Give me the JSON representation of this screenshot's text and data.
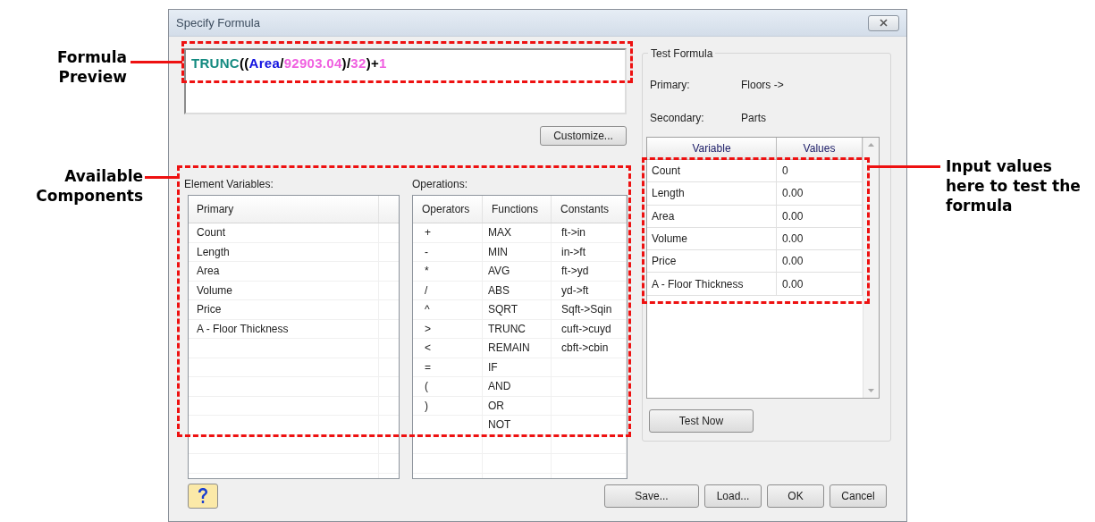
{
  "window": {
    "title": "Specify Formula"
  },
  "formula": [
    {
      "text": "TRUNC",
      "color": "#138a80"
    },
    {
      "text": "((",
      "color": "#000000"
    },
    {
      "text": "Area",
      "color": "#1010e0"
    },
    {
      "text": "/",
      "color": "#000000"
    },
    {
      "text": "92903.04",
      "color": "#f060e0"
    },
    {
      "text": ")/",
      "color": "#000000"
    },
    {
      "text": "32",
      "color": "#f060e0"
    },
    {
      "text": ")+",
      "color": "#000000"
    },
    {
      "text": "1",
      "color": "#f060e0"
    }
  ],
  "customize_button": "Customize...",
  "element_variables": {
    "label": "Element Variables:",
    "column": "Primary",
    "items": [
      "Count",
      "Length",
      "Area",
      "Volume",
      "Price",
      "A - Floor Thickness"
    ]
  },
  "operations": {
    "label": "Operations:",
    "columns": [
      "Operators",
      "Functions",
      "Constants"
    ],
    "rows": [
      {
        "operator": "+",
        "function": "MAX",
        "constant": "ft->in"
      },
      {
        "operator": "-",
        "function": "MIN",
        "constant": "in->ft"
      },
      {
        "operator": "*",
        "function": "AVG",
        "constant": "ft->yd"
      },
      {
        "operator": "/",
        "function": "ABS",
        "constant": "yd->ft"
      },
      {
        "operator": "^",
        "function": "SQRT",
        "constant": "Sqft->Sqin"
      },
      {
        "operator": ">",
        "function": "TRUNC",
        "constant": "cuft->cuyd"
      },
      {
        "operator": "<",
        "function": "REMAIN",
        "constant": "cbft->cbin"
      },
      {
        "operator": "=",
        "function": "IF"
      },
      {
        "operator": "(",
        "function": "AND"
      },
      {
        "operator": ")",
        "function": "OR"
      },
      {
        "function": "NOT"
      }
    ]
  },
  "test_formula": {
    "title": "Test Formula",
    "primary_label": "Primary:",
    "primary_value": "Floors ->",
    "secondary_label": "Secondary:",
    "secondary_value": "Parts",
    "columns": [
      "Variable",
      "Values"
    ],
    "rows": [
      {
        "variable": "Count",
        "value": "0"
      },
      {
        "variable": "Length",
        "value": "0.00"
      },
      {
        "variable": "Area",
        "value": "0.00"
      },
      {
        "variable": "Volume",
        "value": "0.00"
      },
      {
        "variable": "Price",
        "value": "0.00"
      },
      {
        "variable": "A - Floor Thickness",
        "value": "0.00"
      }
    ],
    "test_button": "Test Now"
  },
  "buttons": [
    "Save...",
    "Load...",
    "OK",
    "Cancel"
  ],
  "annotations": [
    {
      "text": "Formula Preview"
    },
    {
      "text": "Available Components"
    },
    {
      "text": "Input values here to test the formula"
    }
  ]
}
